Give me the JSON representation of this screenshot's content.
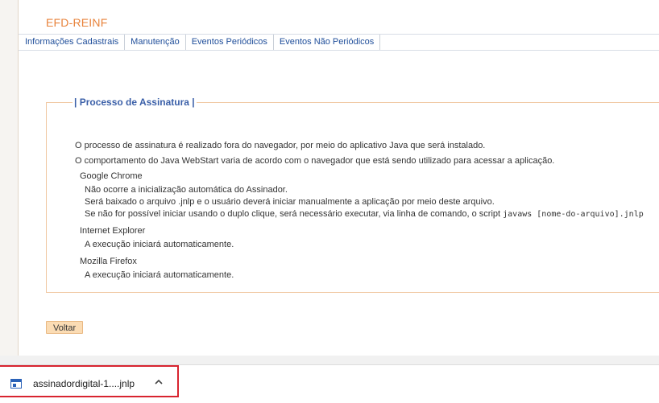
{
  "header": {
    "title": "EFD-REINF"
  },
  "menu": {
    "items": [
      {
        "label": "Informações Cadastrais"
      },
      {
        "label": "Manutenção"
      },
      {
        "label": "Eventos Periódicos"
      },
      {
        "label": "Eventos Não Periódicos"
      }
    ]
  },
  "panel": {
    "legend": "| Processo de Assinatura |",
    "intro": "O processo de assinatura é realizado fora do navegador, por meio do aplicativo Java que será instalado.",
    "behavior": "O comportamento do Java WebStart varia de acordo com o navegador que está sendo utilizado para acessar a aplicação.",
    "chrome": {
      "name": "Google Chrome",
      "line1": "Não ocorre a inicialização automática do Assinador.",
      "line2": "Será baixado o arquivo .jnlp e o usuário deverá iniciar manualmente a aplicação por meio deste arquivo.",
      "line3_prefix": "Se não for possível iniciar usando o duplo clique, será necessário executar, via linha de comando, o script ",
      "line3_code": "javaws [nome-do-arquivo].jnlp"
    },
    "ie": {
      "name": "Internet Explorer",
      "line1": "A execução iniciará automaticamente."
    },
    "firefox": {
      "name": "Mozilla Firefox",
      "line1": "A execução iniciará automaticamente."
    }
  },
  "actions": {
    "back_label": "Voltar"
  },
  "download_bar": {
    "file_name": "assinadordigital-1....jnlp"
  },
  "colors": {
    "accent": "#e8823a",
    "link": "#1f4e9a",
    "legend": "#3a5fa8",
    "button_bg": "#fbdcb4"
  }
}
